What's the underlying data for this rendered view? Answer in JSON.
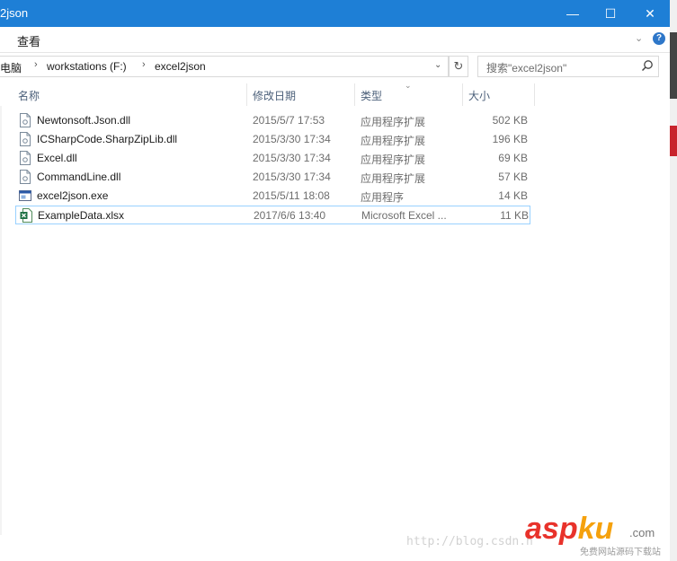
{
  "window": {
    "title": "2json",
    "minimize_glyph": "—",
    "maximize_glyph": "☐",
    "close_glyph": "✕"
  },
  "ribbon": {
    "tab_view": "查看",
    "help_glyph": "?"
  },
  "address": {
    "crumbs": [
      "电脑",
      "workstations (F:)",
      "excel2json"
    ],
    "separator": "›"
  },
  "search": {
    "placeholder": "搜索\"excel2json\""
  },
  "columns": {
    "name": "名称",
    "date": "修改日期",
    "type": "类型",
    "size": "大小"
  },
  "files": [
    {
      "name": "Newtonsoft.Json.dll",
      "date": "2015/5/7 17:53",
      "type": "应用程序扩展",
      "size": "502 KB",
      "icon": "dll-file-icon"
    },
    {
      "name": "ICSharpCode.SharpZipLib.dll",
      "date": "2015/3/30 17:34",
      "type": "应用程序扩展",
      "size": "196 KB",
      "icon": "dll-file-icon"
    },
    {
      "name": "Excel.dll",
      "date": "2015/3/30 17:34",
      "type": "应用程序扩展",
      "size": "69 KB",
      "icon": "dll-file-icon"
    },
    {
      "name": "CommandLine.dll",
      "date": "2015/3/30 17:34",
      "type": "应用程序扩展",
      "size": "57 KB",
      "icon": "dll-file-icon"
    },
    {
      "name": "excel2json.exe",
      "date": "2015/5/11 18:08",
      "type": "应用程序",
      "size": "14 KB",
      "icon": "exe-file-icon"
    },
    {
      "name": "ExampleData.xlsx",
      "date": "2017/6/6 13:40",
      "type": "Microsoft Excel ...",
      "size": "11 KB",
      "icon": "excel-file-icon",
      "selected": true
    }
  ],
  "watermark": {
    "url": "http://blog.csdn.n",
    "logo_asp": "asp",
    "logo_ku": "ku",
    "logo_com": ".com",
    "slogan": "免费网站源码下载站"
  },
  "colors": {
    "titlebar": "#1e7fd6",
    "selection_border": "#99d1ff",
    "watermark_red": "#e8322b",
    "watermark_orange": "#f5a10d"
  }
}
